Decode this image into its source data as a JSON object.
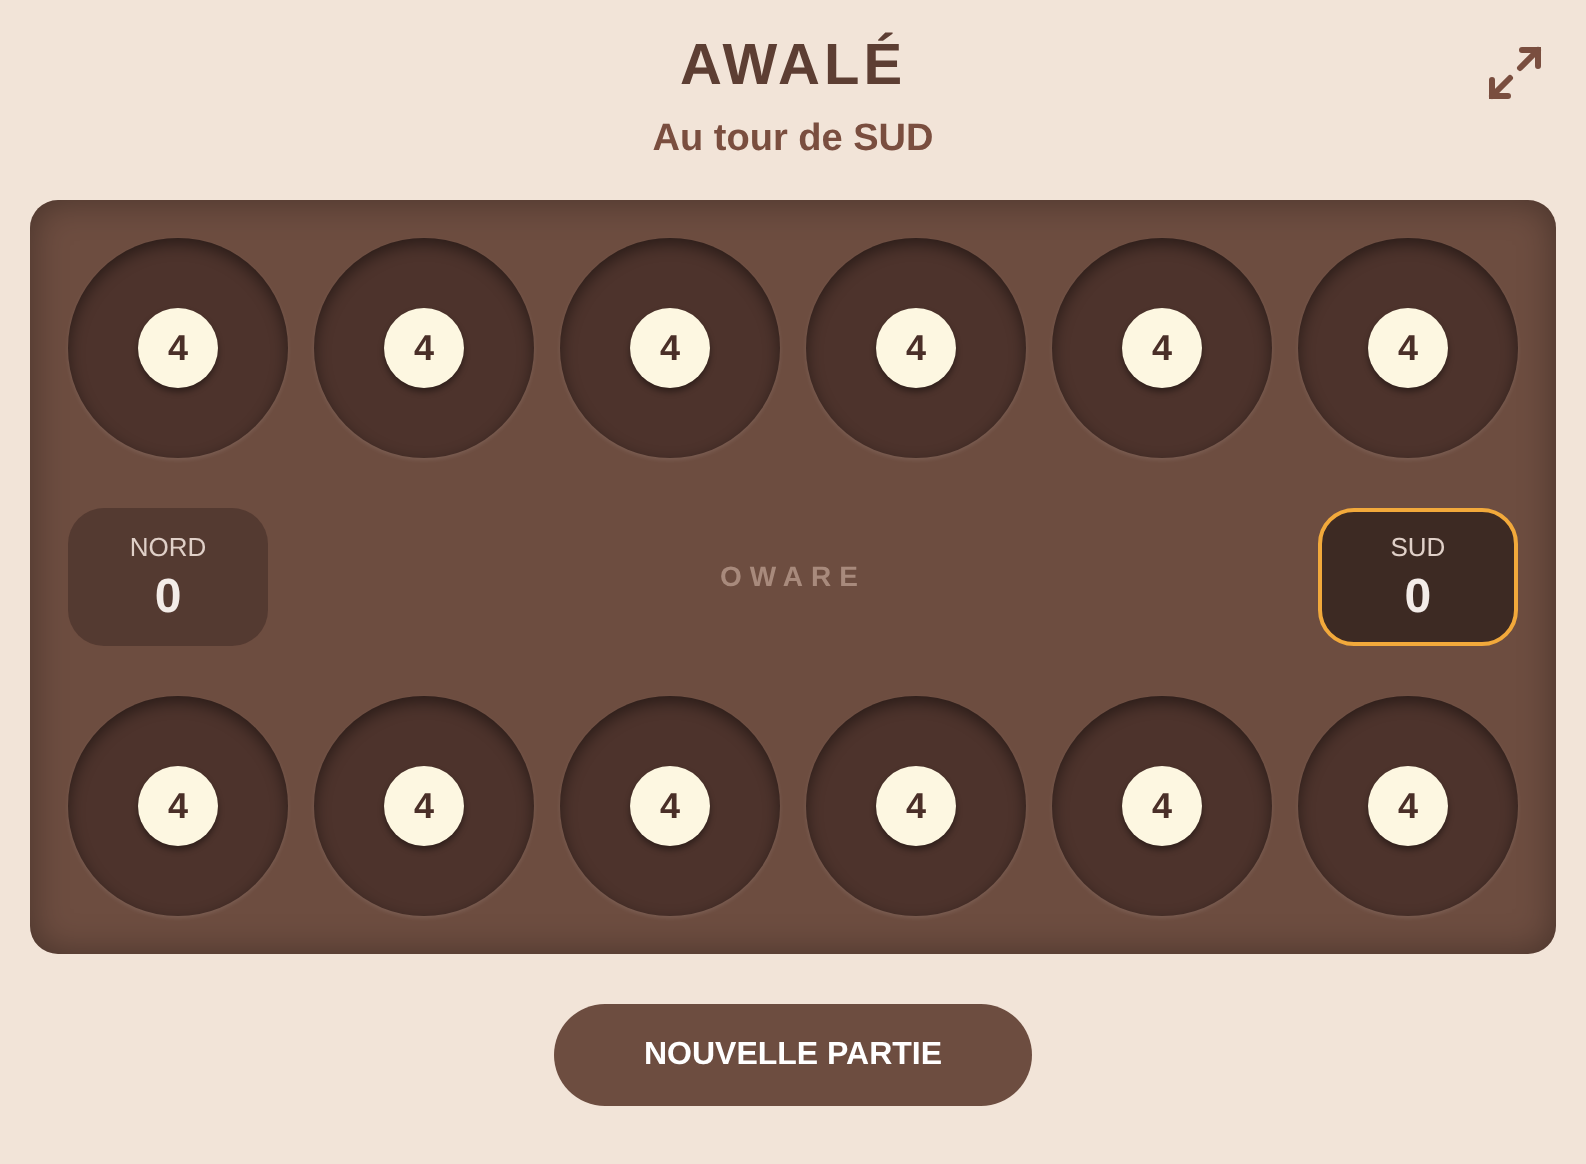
{
  "title": "AWALÉ",
  "status": "Au tour de SUD",
  "board": {
    "label": "OWARE",
    "top_pits": [
      {
        "seeds": "4"
      },
      {
        "seeds": "4"
      },
      {
        "seeds": "4"
      },
      {
        "seeds": "4"
      },
      {
        "seeds": "4"
      },
      {
        "seeds": "4"
      }
    ],
    "stores": [
      {
        "name": "NORD",
        "score": "0",
        "selected": false
      },
      {
        "name": "SUD",
        "score": "0",
        "selected": true
      }
    ],
    "bottom_pits": [
      {
        "seeds": "4"
      },
      {
        "seeds": "4"
      },
      {
        "seeds": "4"
      },
      {
        "seeds": "4"
      },
      {
        "seeds": "4"
      },
      {
        "seeds": "4"
      }
    ]
  },
  "button": "NOUVELLE PARTIE"
}
